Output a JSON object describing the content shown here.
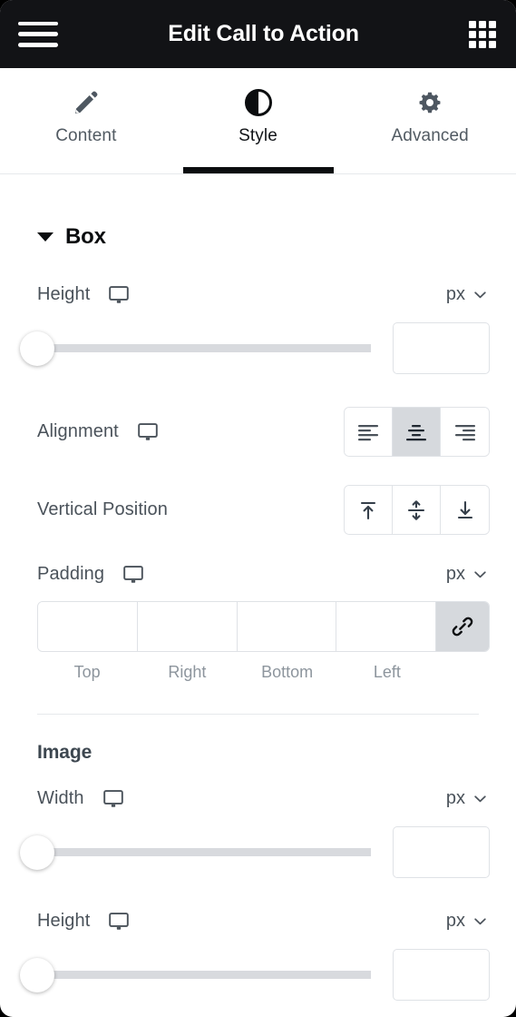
{
  "topbar": {
    "menu_icon": "hamburger-menu-icon",
    "title": "Edit Call to Action",
    "apps_icon": "grid-apps-icon"
  },
  "tabs": [
    {
      "label": "Content",
      "icon": "pencil-icon",
      "active": false
    },
    {
      "label": "Style",
      "icon": "contrast-icon",
      "active": true
    },
    {
      "label": "Advanced",
      "icon": "gear-icon",
      "active": false
    }
  ],
  "box_section": {
    "title": "Box",
    "collapsed": false,
    "height": {
      "label": "Height",
      "responsive_icon": "monitor-icon",
      "unit": "px",
      "unit_chevron": "chevron-down-icon",
      "slider_value": 0,
      "input_value": "",
      "input_placeholder": ""
    },
    "alignment": {
      "label": "Alignment",
      "responsive_icon": "monitor-icon",
      "options": [
        {
          "name": "align-left",
          "selected": false
        },
        {
          "name": "align-center",
          "selected": true
        },
        {
          "name": "align-right",
          "selected": false
        }
      ]
    },
    "vertical_position": {
      "label": "Vertical Position",
      "options": [
        {
          "name": "align-top",
          "selected": false
        },
        {
          "name": "align-middle",
          "selected": false
        },
        {
          "name": "align-bottom",
          "selected": false
        }
      ]
    },
    "padding": {
      "label": "Padding",
      "responsive_icon": "monitor-icon",
      "unit": "px",
      "unit_chevron": "chevron-down-icon",
      "fields": [
        {
          "side": "Top",
          "value": ""
        },
        {
          "side": "Right",
          "value": ""
        },
        {
          "side": "Bottom",
          "value": ""
        },
        {
          "side": "Left",
          "value": ""
        }
      ],
      "link_icon": "link-chain-icon",
      "link_active": true
    }
  },
  "image_section": {
    "title": "Image",
    "width": {
      "label": "Width",
      "responsive_icon": "monitor-icon",
      "unit": "px",
      "unit_chevron": "chevron-down-icon",
      "slider_value": 0,
      "input_value": ""
    },
    "height": {
      "label": "Height",
      "responsive_icon": "monitor-icon",
      "unit": "px",
      "unit_chevron": "chevron-down-icon",
      "slider_value": 0,
      "input_value": ""
    }
  },
  "colors": {
    "topbar_bg": "#121316",
    "panel_bg": "#ffffff",
    "label_text": "#4a525a",
    "muted_text": "#8d959d",
    "active_tab_underline": "#0b0d0f",
    "control_border": "#dfe2e6",
    "active_control_bg": "#d6d9dd",
    "slider_track": "#d8dade"
  }
}
